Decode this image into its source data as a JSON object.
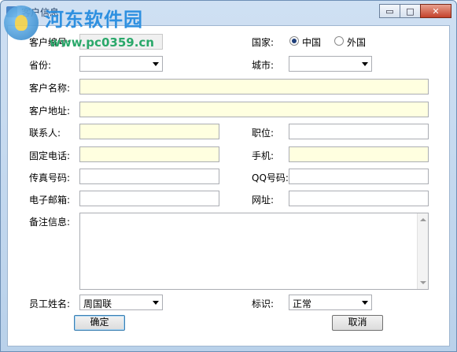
{
  "window": {
    "title": "客户信息",
    "minimize_label": "▭",
    "maximize_label": "□",
    "close_label": "✕"
  },
  "watermark": {
    "brand": "河东软件园",
    "url": "www.pc0359.cn"
  },
  "form": {
    "customer_no": {
      "label": "客户编号:",
      "value": ""
    },
    "country": {
      "label": "国家:",
      "options": [
        "中国",
        "外国"
      ],
      "selected": "中国"
    },
    "province": {
      "label": "省份:",
      "value": ""
    },
    "city": {
      "label": "城市:",
      "value": ""
    },
    "customer_name": {
      "label": "客户名称:",
      "value": ""
    },
    "customer_address": {
      "label": "客户地址:",
      "value": ""
    },
    "contact": {
      "label": "联系人:",
      "value": ""
    },
    "position": {
      "label": "职位:",
      "value": ""
    },
    "phone": {
      "label": "固定电话:",
      "value": ""
    },
    "mobile": {
      "label": "手机:",
      "value": ""
    },
    "fax": {
      "label": "传真号码:",
      "value": ""
    },
    "qq": {
      "label": "QQ号码:",
      "value": ""
    },
    "email": {
      "label": "电子邮箱:",
      "value": ""
    },
    "website": {
      "label": "网址:",
      "value": ""
    },
    "remarks": {
      "label": "备注信息:",
      "value": ""
    },
    "employee": {
      "label": "员工姓名:",
      "value": "周国联"
    },
    "flag": {
      "label": "标识:",
      "value": "正常"
    }
  },
  "buttons": {
    "ok": "确定",
    "cancel": "取消"
  }
}
